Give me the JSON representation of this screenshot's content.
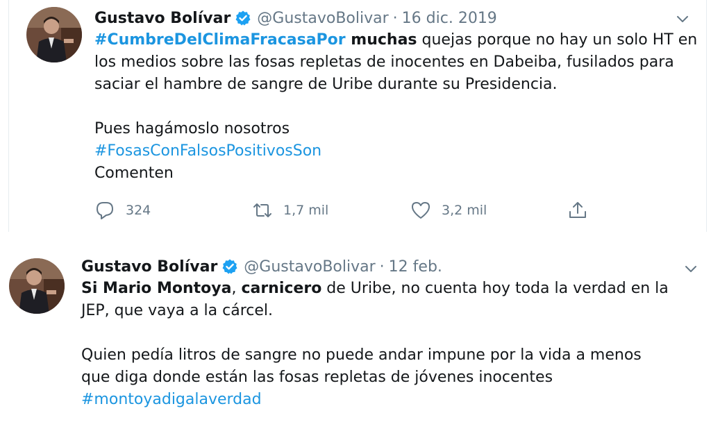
{
  "tweets": [
    {
      "name": "Gustavo Bolívar",
      "handle": "@GustavoBolivar",
      "separator": "·",
      "date": "16 dic. 2019",
      "lines": [
        {
          "hashtag": "#CumbreDelClimaFracasaPor",
          "bold": " muchas",
          "rest": " quejas porque no hay un solo HT en"
        },
        {
          "text": "los medios sobre las fosas repletas de inocentes en Dabeiba, fusilados para"
        },
        {
          "text": "saciar el hambre de sangre de Uribe durante su Presidencia."
        },
        {
          "text": "Pues hagámoslo nosotros"
        },
        {
          "hashtag": "#FosasConFalsosPositivosSon"
        },
        {
          "text": "Comenten"
        }
      ],
      "actions": {
        "replies": "324",
        "retweets": "1,7 mil",
        "likes": "3,2 mil"
      }
    },
    {
      "name": "Gustavo Bolívar",
      "handle": "@GustavoBolivar",
      "separator": "·",
      "date": "12 feb.",
      "lines": [
        {
          "bold1": "Si Mario Montoya",
          "mid1": ", ",
          "bold2": "carnicero",
          "rest": " de Uribe, no cuenta hoy toda la verdad en la"
        },
        {
          "text": "JEP, que vaya a la cárcel."
        },
        {
          "text": "Quien pedía litros de sangre no puede andar impune por la vida a menos"
        },
        {
          "text": "que diga donde están las fosas repletas de jóvenes inocentes"
        },
        {
          "hashtag": "#montoyadigalaverdad"
        }
      ]
    }
  ],
  "icons": {
    "verified": "verified-badge-icon",
    "caret": "chevron-down-icon",
    "reply": "reply-icon",
    "retweet": "retweet-icon",
    "like": "heart-icon",
    "share": "share-icon"
  },
  "colors": {
    "link": "#1b95e0",
    "verified": "#1da1f2",
    "secondary": "#657786",
    "text": "#14171a"
  }
}
